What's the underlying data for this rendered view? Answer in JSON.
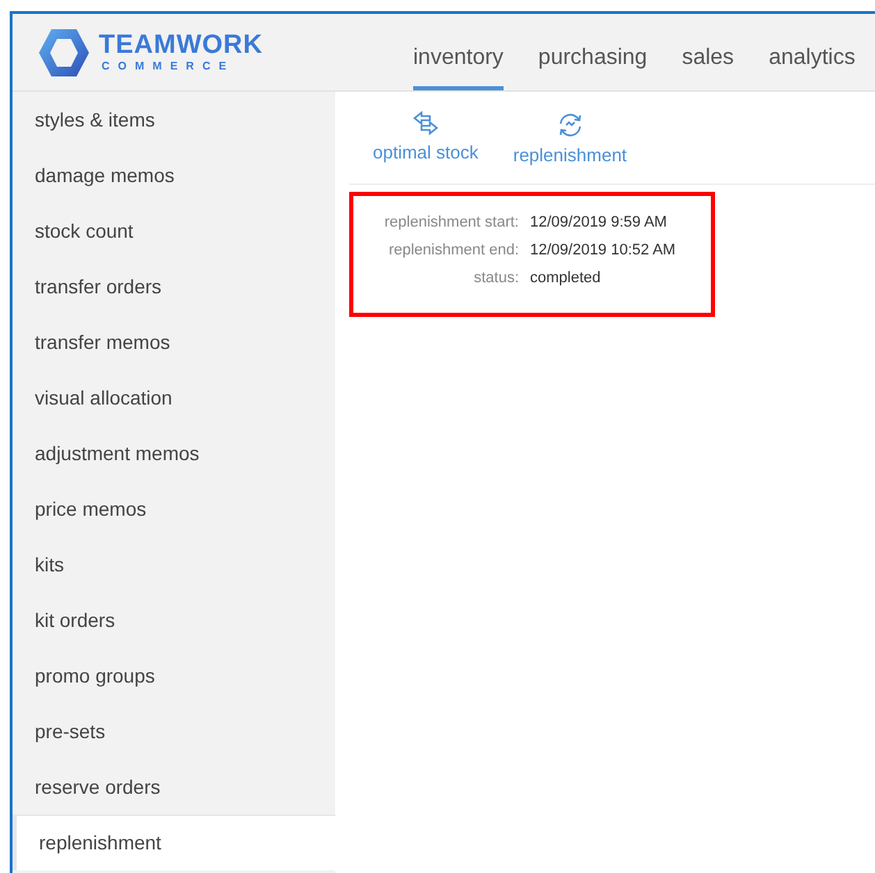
{
  "logo": {
    "line_1": "TEAMWORK",
    "line_2": "COMMERCE"
  },
  "nav_tabs": [
    {
      "label": "inventory",
      "selected": true
    },
    {
      "label": "purchasing",
      "selected": false
    },
    {
      "label": "sales",
      "selected": false
    },
    {
      "label": "analytics",
      "selected": false
    }
  ],
  "sidebar": {
    "items": [
      {
        "label": "styles & items",
        "selected": false
      },
      {
        "label": "damage memos",
        "selected": false
      },
      {
        "label": "stock count",
        "selected": false
      },
      {
        "label": "transfer orders",
        "selected": false
      },
      {
        "label": "transfer memos",
        "selected": false
      },
      {
        "label": "visual allocation",
        "selected": false
      },
      {
        "label": "adjustment memos",
        "selected": false
      },
      {
        "label": "price memos",
        "selected": false
      },
      {
        "label": "kits",
        "selected": false
      },
      {
        "label": "kit orders",
        "selected": false
      },
      {
        "label": "promo groups",
        "selected": false
      },
      {
        "label": "pre-sets",
        "selected": false
      },
      {
        "label": "reserve orders",
        "selected": false
      },
      {
        "label": "replenishment",
        "selected": true
      }
    ]
  },
  "toolbar": [
    {
      "kind": "swap",
      "label": "optimal stock"
    },
    {
      "kind": "refresh",
      "label": "replenishment"
    }
  ],
  "details": [
    {
      "label": "replenishment start:",
      "value": "12/09/2019 9:59 AM"
    },
    {
      "label": "replenishment end:",
      "value": "12/09/2019 10:52 AM"
    },
    {
      "label": "status:",
      "value": "completed"
    }
  ]
}
